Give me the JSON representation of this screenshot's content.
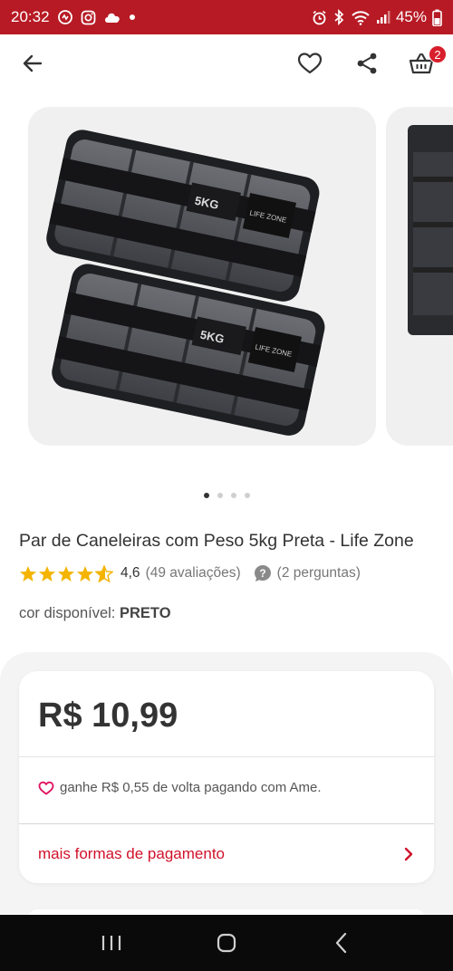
{
  "status_bar": {
    "time": "20:32",
    "battery": "45%",
    "background": "#b71a24"
  },
  "header": {
    "cart_count": "2",
    "accent": "#d81e2c"
  },
  "gallery": {
    "slides": [
      {
        "label_tag_1": "5KG",
        "label_tag_2": "LIFE ZONE"
      },
      {
        "label_tag_1": "5KG",
        "label_tag_2": "LIFE ZONE"
      }
    ],
    "dots": 4,
    "active_dot": 0
  },
  "product": {
    "title": "Par de Caneleiras com Peso 5kg Preta - Life Zone",
    "rating": "4,6",
    "rating_value": 4.6,
    "reviews": "(49 avaliações)",
    "questions": "(2 perguntas)",
    "color_label": "cor disponível:",
    "color_value": "PRETO"
  },
  "price_card": {
    "price": "R$ 10,99",
    "cashback": "ganhe R$ 0,55 de volta pagando com Ame.",
    "payment_link": "mais formas de pagamento",
    "link_color": "#d1122a"
  }
}
